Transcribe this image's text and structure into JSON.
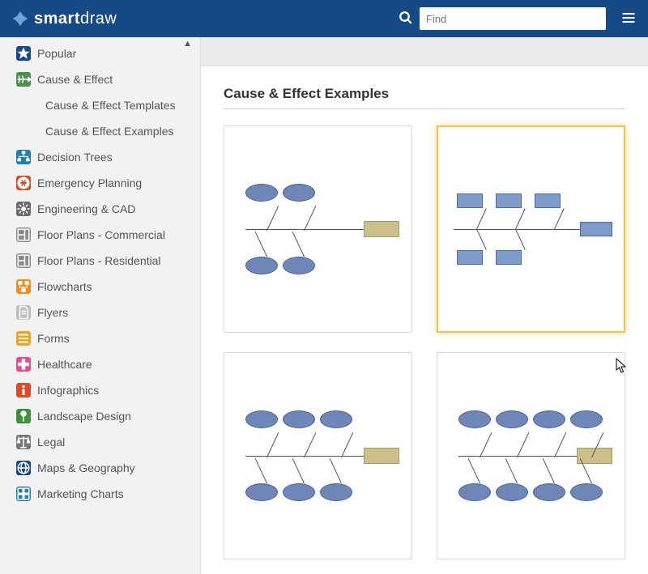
{
  "header": {
    "brand_bold": "smart",
    "brand_light": "draw",
    "search_placeholder": "Find"
  },
  "sidebar": {
    "items": [
      {
        "label": "Popular",
        "icon": "star-icon",
        "bg": "#164a87",
        "fg": "#fff"
      },
      {
        "label": "Cause & Effect",
        "icon": "fishbone-icon",
        "bg": "#4a8f4a",
        "fg": "#fff",
        "expanded": true,
        "children": [
          {
            "label": "Cause & Effect Templates"
          },
          {
            "label": "Cause & Effect Examples"
          }
        ]
      },
      {
        "label": "Decision Trees",
        "icon": "tree-icon",
        "bg": "#1f7fb8",
        "fg": "#fff"
      },
      {
        "label": "Emergency Planning",
        "icon": "alert-icon",
        "bg": "#d94b2b",
        "fg": "#fff"
      },
      {
        "label": "Engineering & CAD",
        "icon": "gear-icon",
        "bg": "#6b6b6b",
        "fg": "#fff"
      },
      {
        "label": "Floor Plans - Commercial",
        "icon": "floorplan-icon",
        "bg": "#8a8a8a",
        "fg": "#fff"
      },
      {
        "label": "Floor Plans - Residential",
        "icon": "floorplan-icon",
        "bg": "#8a8a8a",
        "fg": "#fff"
      },
      {
        "label": "Flowcharts",
        "icon": "flowchart-icon",
        "bg": "#f28c1f",
        "fg": "#fff"
      },
      {
        "label": "Flyers",
        "icon": "page-icon",
        "bg": "#bfbfbf",
        "fg": "#fff"
      },
      {
        "label": "Forms",
        "icon": "form-icon",
        "bg": "#f2a51f",
        "fg": "#fff"
      },
      {
        "label": "Healthcare",
        "icon": "medical-icon",
        "bg": "#e64a8f",
        "fg": "#fff"
      },
      {
        "label": "Infographics",
        "icon": "info-icon",
        "bg": "#d94b2b",
        "fg": "#fff"
      },
      {
        "label": "Landscape Design",
        "icon": "landscape-icon",
        "bg": "#3f8f3f",
        "fg": "#fff"
      },
      {
        "label": "Legal",
        "icon": "scales-icon",
        "bg": "#777",
        "fg": "#fff"
      },
      {
        "label": "Maps & Geography",
        "icon": "globe-icon",
        "bg": "#164a87",
        "fg": "#fff"
      },
      {
        "label": "Marketing Charts",
        "icon": "grid-icon",
        "bg": "#1f7fb8",
        "fg": "#fff"
      }
    ]
  },
  "main": {
    "section_title": "Cause & Effect Examples",
    "cards": [
      {
        "name": "cause-effect-ovals-1",
        "variant": "ovals",
        "selected": false
      },
      {
        "name": "cause-effect-boxes",
        "variant": "boxes",
        "selected": true
      },
      {
        "name": "cause-effect-ovals-2",
        "variant": "ovals6",
        "selected": false
      },
      {
        "name": "cause-effect-ovals-3",
        "variant": "ovals8",
        "selected": false
      }
    ]
  }
}
